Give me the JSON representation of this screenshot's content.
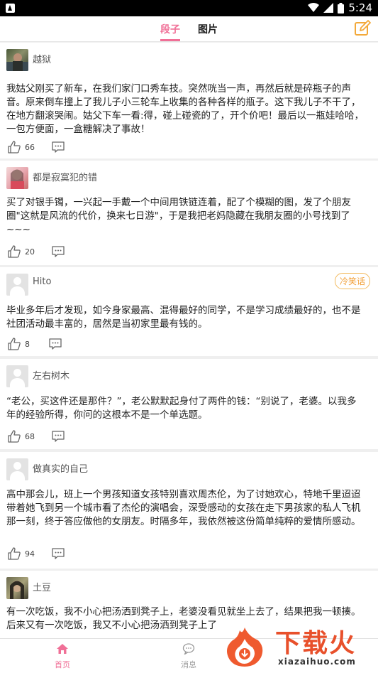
{
  "statusbar": {
    "time": "5:24"
  },
  "header": {
    "tabs": [
      {
        "label": "段子",
        "active": true
      },
      {
        "label": "图片",
        "active": false
      }
    ],
    "accent": "#f07097"
  },
  "posts": [
    {
      "username": "越狱",
      "content": "我姑父刚买了新车，在我们家门口秀车技。突然咣当一声，再然后就是碎瓶子的声音。原来倒车撞上了我儿子小三轮车上收集的各种各样的瓶子。这下我儿子不干了，在地方翻滚哭闹。姑父下车一看:得，碰上碰瓷的了，开个价吧！最后以一瓶娃哈哈，一包方便面，一盒糖解决了事故！",
      "likes": "66"
    },
    {
      "username": "都是寂寞犯的错",
      "content": "买了对银手镯，一兴起一手戴一个中间用铁链连着，配了个模糊的图，发了个朋友圈\"这就是风流的代价，换来七日游\"，于是我把老妈隐藏在我朋友圈的小号找到了~~~",
      "likes": "20"
    },
    {
      "username": "Hito",
      "tag": "冷笑话",
      "content": "毕业多年后才发现，如今身家最高、混得最好的同学，不是学习成绩最好的，也不是社团活动最丰富的，居然是当初家里最有钱的。",
      "likes": "8"
    },
    {
      "username": "左右树木",
      "content": "“老公，买这件还是那件？”，老公默默起身付了两件的钱：“别说了，老婆。以我多年的经验所得，你问的这根本不是一个单选题。",
      "likes": "68"
    },
    {
      "username": "做真实的自己",
      "content": "高中那会儿，班上一个男孩知道女孩特别喜欢周杰伦，为了讨她欢心，特地千里迢迢带着她飞到另一个城市看了杰伦的演唱会，深受感动的女孩在走下男孩家的私人飞机那一刻，终于答应做他的女朋友。时隔多年，我依然被这份简单纯粹的爱情所感动。",
      "likes": "94"
    },
    {
      "username": "土豆",
      "content": "有一次吃饭，我不小心把汤洒到凳子上，老婆没看见就坐上去了，结果把我一顿揍。后来又有一次吃饭，我又不小心把汤洒到凳子上了"
    }
  ],
  "tabbar": {
    "items": [
      {
        "label": "首页",
        "icon": "home-icon",
        "active": true
      },
      {
        "label": "消息",
        "icon": "message-icon",
        "active": false
      }
    ]
  },
  "watermark": {
    "title": "下载火",
    "url": "xiazaihuo.com"
  }
}
